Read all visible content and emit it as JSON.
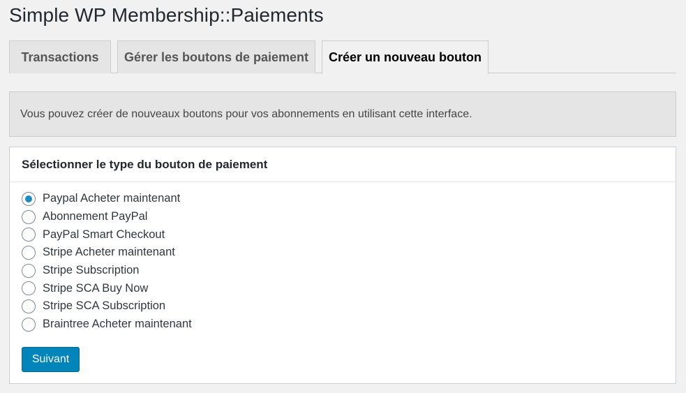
{
  "page": {
    "title": "Simple WP Membership::Paiements"
  },
  "tabs": [
    {
      "label": "Transactions",
      "active": false
    },
    {
      "label": "Gérer les boutons de paiement",
      "active": false
    },
    {
      "label": "Créer un nouveau bouton",
      "active": true
    }
  ],
  "notice": {
    "text": "Vous pouvez créer de nouveaux boutons pour vos abonnements en utilisant cette interface."
  },
  "panel": {
    "title": "Sélectionner le type du bouton de paiement",
    "options": [
      {
        "label": "Paypal Acheter maintenant",
        "checked": true
      },
      {
        "label": "Abonnement PayPal",
        "checked": false
      },
      {
        "label": "PayPal Smart Checkout",
        "checked": false
      },
      {
        "label": "Stripe Acheter maintenant",
        "checked": false
      },
      {
        "label": "Stripe Subscription",
        "checked": false
      },
      {
        "label": "Stripe SCA Buy Now",
        "checked": false
      },
      {
        "label": "Stripe SCA Subscription",
        "checked": false
      },
      {
        "label": "Braintree Acheter maintenant",
        "checked": false
      }
    ],
    "next_label": "Suivant"
  },
  "colors": {
    "accent": "#0085ba",
    "radio_checked": "#1e8cbe",
    "background": "#f1f1f1"
  }
}
